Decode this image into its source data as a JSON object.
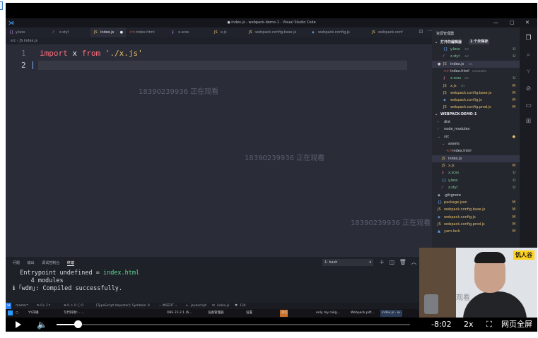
{
  "window_title": "● index.js - webpack-demo-1 - Visual Studio Code",
  "watermark": "18390239936 正在观看",
  "tabs": [
    {
      "icon": "{}",
      "label": "y.less"
    },
    {
      "icon": "⁄",
      "label": "z.styl"
    },
    {
      "icon": "JS",
      "label": "index.js",
      "active": true,
      "dirty": "●"
    },
    {
      "icon": "<>",
      "label": "index.html"
    },
    {
      "icon": "∮",
      "label": "x.scss"
    },
    {
      "icon": "JS",
      "label": "x.js"
    },
    {
      "icon": "JS",
      "label": "webpack.config.base.js"
    },
    {
      "icon": "◈",
      "label": "webpack.config.js"
    },
    {
      "icon": "JS",
      "label": "webpack.conf"
    }
  ],
  "breadcrumb": [
    "src",
    "JS index.js"
  ],
  "editor": {
    "line_numbers": [
      "1",
      "2"
    ],
    "code": {
      "kw1": "import",
      "id": " x ",
      "kw2": "from",
      "sp": " ",
      "str": "'./x.js'"
    }
  },
  "explorer": {
    "header": "资源管理器",
    "open_editors_label": "打开的编辑器",
    "open_editors_badge": "1 个未保存",
    "open_editors": [
      {
        "icon": "{}",
        "name": "y.less",
        "dir": "src",
        "status": "U"
      },
      {
        "icon": "⁄",
        "name": "z.styl",
        "dir": "src",
        "status": "U"
      },
      {
        "icon": "JS",
        "name": "index.js",
        "dir": "src",
        "status": "",
        "dirty": true
      },
      {
        "icon": "<>",
        "name": "index.html",
        "dir": "src\\assets",
        "status": ""
      },
      {
        "icon": "∮",
        "name": "x.scss",
        "dir": "src",
        "status": "U"
      },
      {
        "icon": "JS",
        "name": "x.js",
        "dir": "src",
        "status": "M"
      },
      {
        "icon": "JS",
        "name": "webpack.config.base.js",
        "dir": "",
        "status": "M"
      },
      {
        "icon": "◈",
        "name": "webpack.config.js",
        "dir": "",
        "status": "M"
      },
      {
        "icon": "JS",
        "name": "webpack.config.prod.js",
        "dir": "",
        "status": "M"
      }
    ],
    "project_label": "WEBPACK-DEMO-1",
    "tree": [
      {
        "icon": "›",
        "name": "dist",
        "status": ""
      },
      {
        "icon": "›",
        "name": "node_modules",
        "status": ""
      },
      {
        "icon": "⌄",
        "name": "src",
        "status": "●"
      },
      {
        "icon": "⌄",
        "name": "assets",
        "status": ""
      },
      {
        "icon": "<>",
        "name": "index.html",
        "status": ""
      },
      {
        "icon": "JS",
        "name": "index.js",
        "status": ""
      },
      {
        "icon": "JS",
        "name": "x.js",
        "status": "M"
      },
      {
        "icon": "∮",
        "name": "x.scss",
        "status": "U"
      },
      {
        "icon": "{}",
        "name": "y.less",
        "status": "U"
      },
      {
        "icon": "⁄",
        "name": "z.styl",
        "status": "U"
      },
      {
        "icon": "◆",
        "name": ".gitignore",
        "status": ""
      },
      {
        "icon": "{}",
        "name": "package.json",
        "status": "M"
      },
      {
        "icon": "JS",
        "name": "webpack.config.base.js",
        "status": "M"
      },
      {
        "icon": "◈",
        "name": "webpack.config.js",
        "status": "M"
      },
      {
        "icon": "JS",
        "name": "webpack.config.prod.js",
        "status": "M"
      },
      {
        "icon": "▲",
        "name": "yarn.lock",
        "status": "M"
      }
    ]
  },
  "terminal": {
    "tabs": [
      "问题",
      "输出",
      "调试控制台",
      "终端"
    ],
    "shell": "1: bash",
    "lines": [
      {
        "pre": "  Entrypoint ",
        "mid": "undefined",
        "post": " = ",
        "link": "index.html"
      },
      {
        "pre": "     4 modules",
        "mid": "",
        "post": "",
        "link": ""
      },
      {
        "pre": "ℹ ｢wdm｣: Compiled successfully.",
        "mid": "",
        "post": "",
        "link": ""
      }
    ]
  },
  "statusbar": {
    "branch": "master*",
    "sync": "⟳ 0↓ 1↑",
    "problems": "⊗ 0 ⚠ 0 ⓘ 0",
    "ts": "[TypeScript Importer]: Symbols: 0",
    "mode": "-- INSERT --",
    "lang": "javascript",
    "file": "index.js",
    "count": "134"
  },
  "taskbar": [
    {
      "label": "YY开播"
    },
    {
      "label": "写代码啦! - ..."
    },
    {
      "label": "OBS 23.2.1 (6..."
    },
    {
      "label": "设备管理器"
    },
    {
      "label": "设置"
    },
    {
      "label": "微信"
    },
    {
      "label": "only my railg..."
    },
    {
      "label": "Webpack.pdf..."
    },
    {
      "label": "index.js - w..."
    }
  ],
  "webcam": {
    "badge": "饥人谷",
    "watermark": "观看"
  },
  "player": {
    "time": "-8:02",
    "speed": "2x",
    "fullscreen_label": "网页全屏",
    "volume_level": 0.06
  },
  "colors": {
    "keyword": "#ff6f7d",
    "string": "#e7c06a",
    "accent": "#2f80ed",
    "badge": "#ffd21c"
  }
}
